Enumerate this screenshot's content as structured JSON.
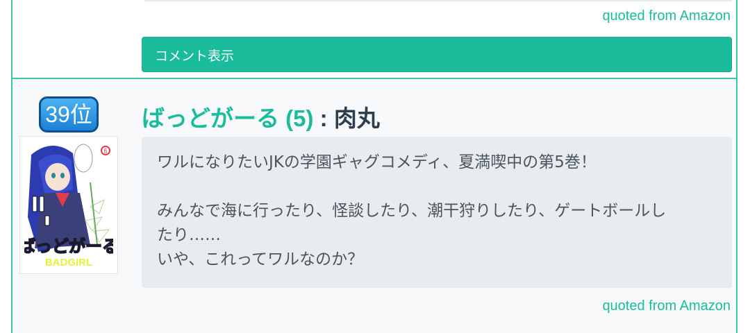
{
  "previous_entry": {
    "quote_label": "quoted from Amazon",
    "comment_button": "コメント表示"
  },
  "entry": {
    "rank": "39位",
    "cover_art_text": "ばっどがーる",
    "title": "ばっどがーる (5)",
    "separator": " : ",
    "author": "肉丸",
    "description": {
      "line1": "ワルになりたいJKの学園ギャグコメディ、夏満喫中の第5巻！",
      "line2": "みんなで海に行ったり、怪談したり、潮干狩りしたり、ゲートボールし",
      "line3": "たり……",
      "line4": "いや、これってワルなのか？"
    },
    "quote_label": "quoted from Amazon"
  },
  "colors": {
    "accent": "#1abc9c",
    "border": "#3cc6a8",
    "rank_badge": "#1b7fd6"
  }
}
